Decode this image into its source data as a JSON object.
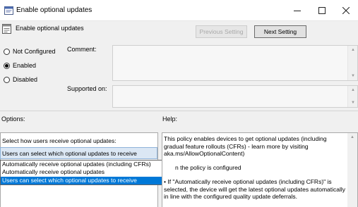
{
  "window": {
    "title": "Enable optional updates",
    "controls": [
      "minimize-icon",
      "maximize-icon",
      "close-icon"
    ]
  },
  "header": {
    "setting_name": "Enable optional updates"
  },
  "buttons": {
    "previous_setting": "Previous Setting",
    "next_setting": "Next Setting"
  },
  "state": {
    "options": [
      {
        "label": "Not Configured",
        "selected": false
      },
      {
        "label": "Enabled",
        "selected": true
      },
      {
        "label": "Disabled",
        "selected": false
      }
    ]
  },
  "fields": {
    "comment_label": "Comment:",
    "comment_value": "",
    "supported_on_label": "Supported on:",
    "supported_on_value": ""
  },
  "sections": {
    "options_label": "Options:",
    "help_label": "Help:"
  },
  "options_panel": {
    "prompt": "Select how users receive optional updates:",
    "combo_value": "Users can select which optional updates to receive",
    "dropdown_items": [
      "Automatically receive optional updates (including CFRs)",
      "Automatically receive optional updates",
      "Users can select which optional updates to receive"
    ],
    "selected_index": 2
  },
  "help": {
    "paragraphs": [
      "This policy enables devices to get optional updates (including gradual feature rollouts (CFRs) - learn more by visiting aka.ms/AllowOptionalContent)",
      "n the policy is configured",
      "• If \"Automatically receive optional updates (including CFRs)\" is selected, the device will get the latest optional updates automatically in line with the configured quality update deferrals."
    ]
  }
}
